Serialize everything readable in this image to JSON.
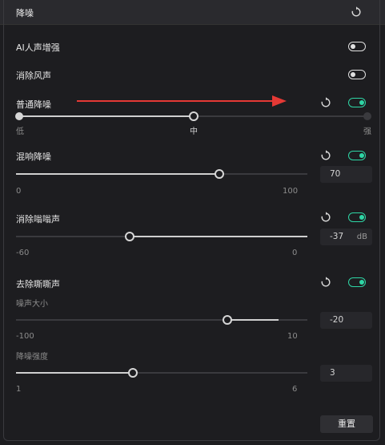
{
  "header": {
    "title": "降噪"
  },
  "sections": {
    "ai_voice": {
      "label": "AI人声增强",
      "enabled": false
    },
    "wind": {
      "label": "消除风声",
      "enabled": false
    },
    "normal": {
      "label": "普通降噪",
      "enabled": true,
      "level_labels": [
        "低",
        "中",
        "强"
      ],
      "selected": "中"
    },
    "reverb": {
      "label": "混响降噪",
      "enabled": true,
      "value": "70",
      "min": "0",
      "max": "100"
    },
    "hum": {
      "label": "消除嗡嗡声",
      "enabled": true,
      "value": "-37",
      "unit": "dB",
      "min": "-60",
      "max": "0"
    },
    "hiss": {
      "label": "去除嘶嘶声",
      "enabled": true,
      "noise": {
        "label": "噪声大小",
        "value": "-20",
        "min": "-100",
        "max": "10"
      },
      "strength": {
        "label": "降噪强度",
        "value": "3",
        "min": "1",
        "max": "6"
      }
    }
  },
  "footer": {
    "reset_label": "重置"
  },
  "colors": {
    "accent": "#2ed6a5",
    "arrow": "#e53935"
  }
}
